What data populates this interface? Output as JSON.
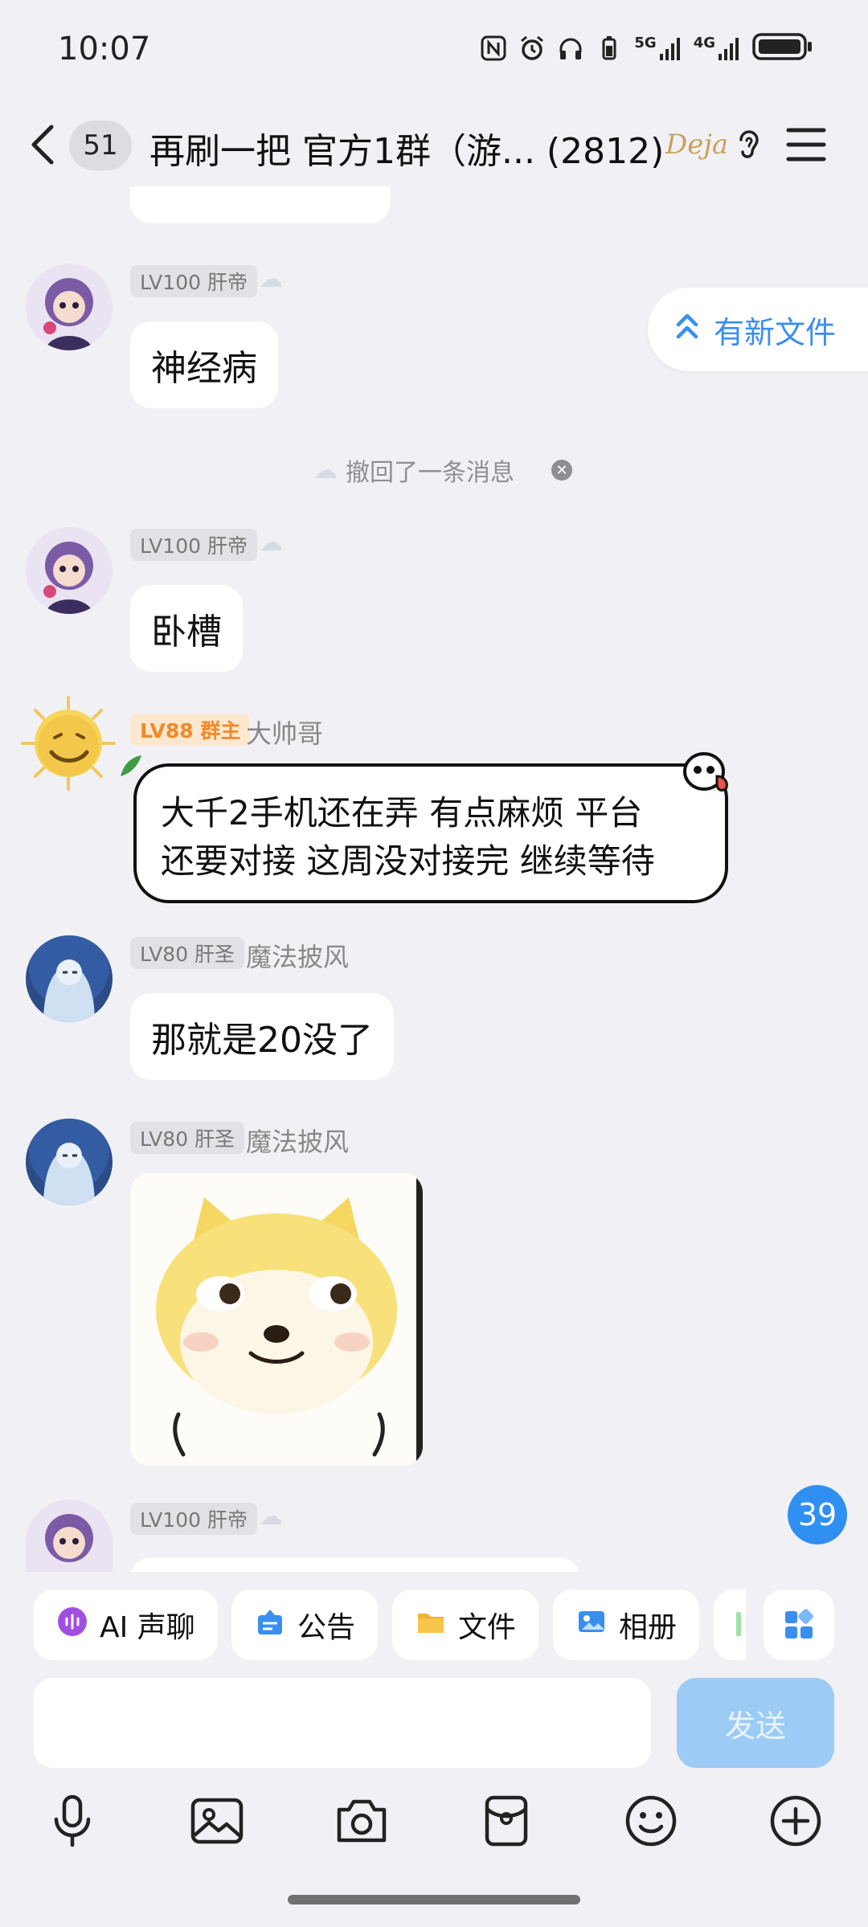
{
  "status_bar": {
    "time": "10:07",
    "net_5g": "5G",
    "net_4g": "4G"
  },
  "header": {
    "unread_count": "51",
    "title": "再刷一把 官方1群（游... (2812)",
    "badge_text": "Deja"
  },
  "new_file_tip": {
    "label": "有新文件"
  },
  "recall_notice": {
    "text": "撤回了一条消息"
  },
  "messages": [
    {
      "level": "LV100 肝帝",
      "nickname": "",
      "text": "神经病"
    },
    {
      "level": "LV100 肝帝",
      "nickname": "",
      "text": "卧槽"
    },
    {
      "level": "LV88 群主",
      "nickname": "大帅哥",
      "line1": "大千2手机还在弄 有点麻烦 平台",
      "line2": "还要对接 这周没对接完 继续等待"
    },
    {
      "level": "LV80 肝圣",
      "nickname": "魔法披风",
      "text": "那就是20没了"
    },
    {
      "level": "LV80 肝圣",
      "nickname": "魔法披风",
      "sticker": "shiba-sticker"
    },
    {
      "level": "LV100 肝帝",
      "nickname": ""
    }
  ],
  "new_message_badge": "39",
  "quick_actions": [
    {
      "label": "AI 声聊",
      "icon": "ai-voice-icon"
    },
    {
      "label": "公告",
      "icon": "announcement-icon"
    },
    {
      "label": "文件",
      "icon": "folder-icon"
    },
    {
      "label": "相册",
      "icon": "album-icon"
    }
  ],
  "composer": {
    "send_label": "发送",
    "placeholder": ""
  },
  "toolbar_icons": [
    "microphone-icon",
    "image-icon",
    "camera-icon",
    "red-packet-icon",
    "emoji-icon",
    "plus-icon"
  ],
  "colors": {
    "accent": "#2f8ff2",
    "owner_tag": "#f08a2a",
    "send_disabled": "#9ccbf5"
  }
}
